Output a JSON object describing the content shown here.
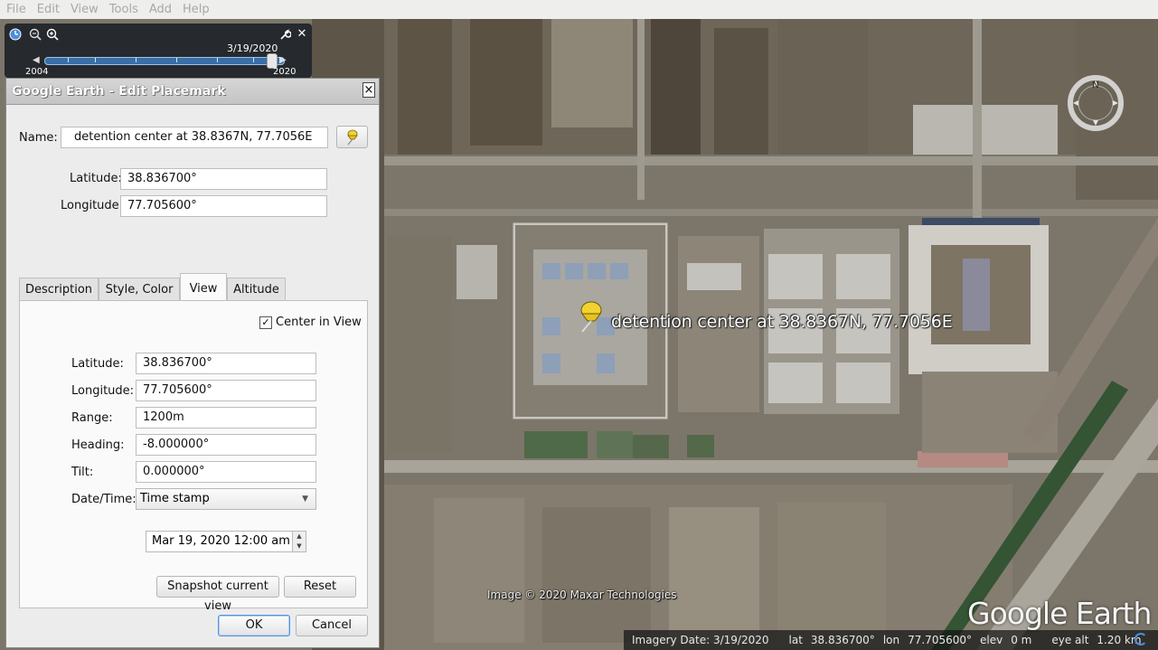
{
  "menu": {
    "items": [
      "File",
      "Edit",
      "View",
      "Tools",
      "Add",
      "Help"
    ]
  },
  "time_slider": {
    "current_date": "3/19/2020",
    "start_year": "2004",
    "end_year": "2020"
  },
  "dialog": {
    "title": "Google Earth - Edit Placemark",
    "close_glyph": "×",
    "name_label": "Name:",
    "name_value": "detention center at 38.8367N, 77.7056E",
    "latitude_label": "Latitude:",
    "latitude_value": "38.836700°",
    "longitude_label": "Longitude:",
    "longitude_value": "77.705600°",
    "tabs": [
      "Description",
      "Style, Color",
      "View",
      "Altitude"
    ],
    "active_tab": "View",
    "view": {
      "center_in_view_label": "Center in View",
      "center_in_view_checked": true,
      "check_glyph": "✓",
      "latitude_label": "Latitude:",
      "latitude_value": "38.836700°",
      "longitude_label": "Longitude:",
      "longitude_value": "77.705600°",
      "range_label": "Range:",
      "range_value": "1200m",
      "heading_label": "Heading:",
      "heading_value": "-8.000000°",
      "tilt_label": "Tilt:",
      "tilt_value": "0.000000°",
      "datetime_label": "Date/Time:",
      "datetime_mode": "Time stamp",
      "timestamp_value": "Mar 19, 2020 12:00 am",
      "snapshot_label": "Snapshot current view",
      "reset_label": "Reset"
    },
    "ok_label": "OK",
    "cancel_label": "Cancel"
  },
  "map": {
    "placemark_label": "detention center at 38.8367N, 77.7056E",
    "copyright": "Image © 2020 Maxar Technologies",
    "logo": "Google Earth",
    "compass_letter": "N"
  },
  "status_bar": {
    "imagery_date": "Imagery Date: 3/19/2020",
    "lat_label": "lat",
    "lat_value": "38.836700°",
    "lon_label": "lon",
    "lon_value": "77.705600°",
    "elev_label": "elev",
    "elev_value": "0 m",
    "eye_alt_label": "eye alt",
    "eye_alt_value": "1.20 km"
  },
  "colors": {
    "placemark_pin": "#f2d230",
    "accent_blue": "#3a6ea8"
  }
}
